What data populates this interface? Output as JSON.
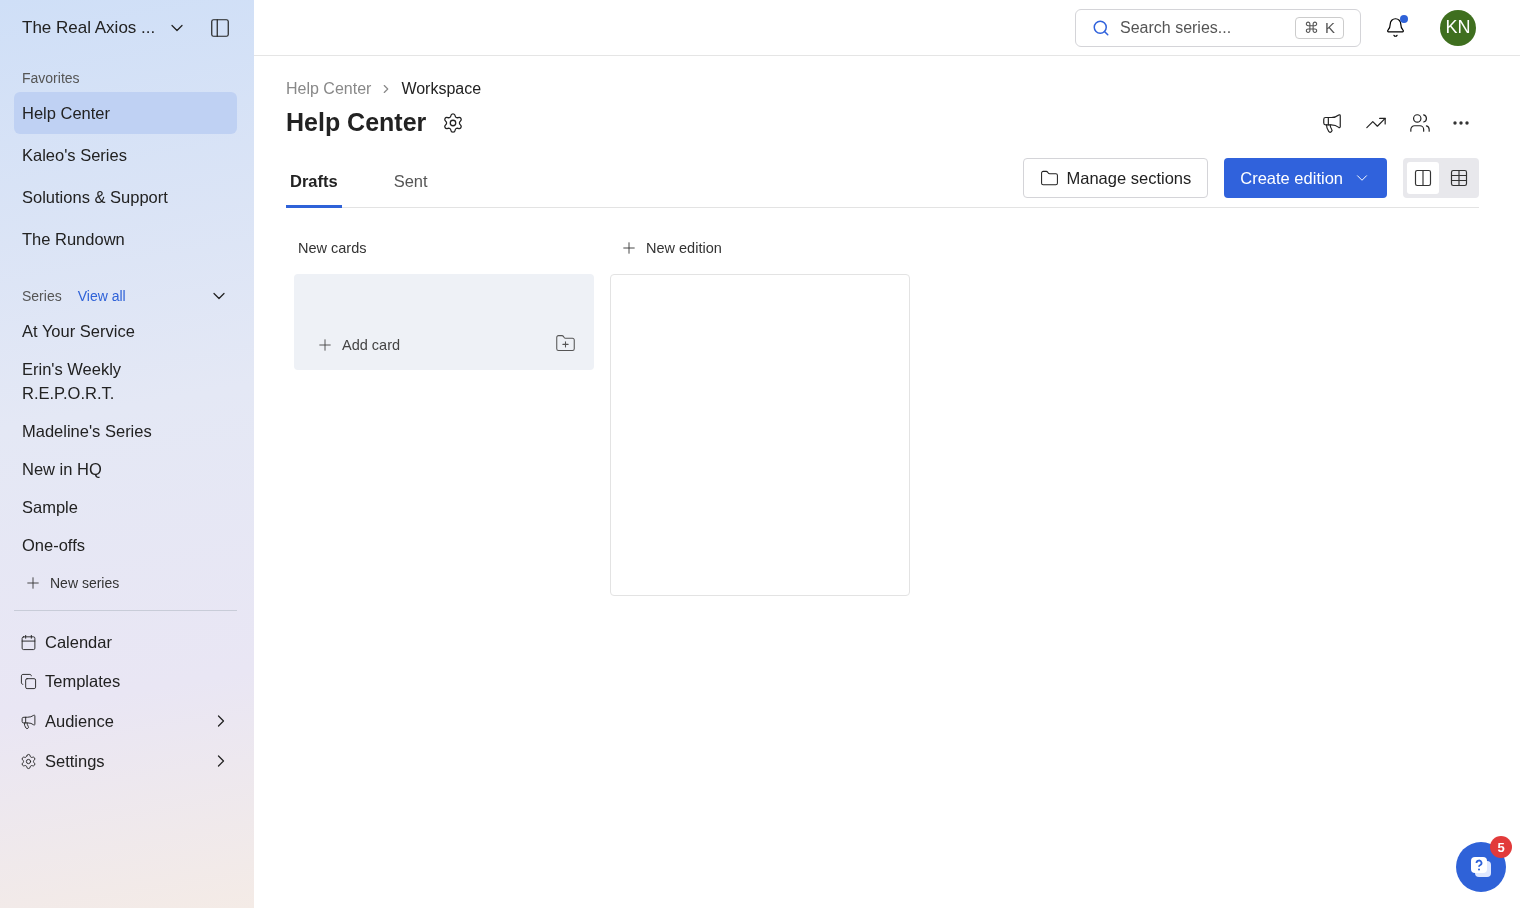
{
  "sidebar": {
    "workspace": "The Real Axios ...",
    "favorites": {
      "heading": "Favorites",
      "items": [
        {
          "label": "Help Center",
          "selected": true
        },
        {
          "label": "Kaleo's Series",
          "selected": false
        },
        {
          "label": "Solutions & Support",
          "selected": false
        },
        {
          "label": "The Rundown",
          "selected": false
        }
      ]
    },
    "series": {
      "heading": "Series",
      "view_all": "View all",
      "expanded": true,
      "items": [
        {
          "label": "At Your Service",
          "selected": false
        },
        {
          "label": "Erin's Weekly R.E.P.O.R.T.",
          "selected": false
        },
        {
          "label": "Madeline's Series",
          "selected": false
        },
        {
          "label": "New in HQ",
          "selected": false
        },
        {
          "label": "Sample",
          "selected": false
        },
        {
          "label": "One-offs",
          "selected": false
        }
      ],
      "new_series": "New series"
    },
    "nav": [
      {
        "kind": "calendar",
        "label": "Calendar",
        "submenu": false
      },
      {
        "kind": "templates",
        "label": "Templates",
        "submenu": false
      },
      {
        "kind": "audience",
        "label": "Audience",
        "submenu": true
      },
      {
        "kind": "settings",
        "label": "Settings",
        "submenu": true
      }
    ]
  },
  "topbar": {
    "search": {
      "placeholder": "Search series...",
      "shortcut": [
        "⌘",
        "K"
      ]
    },
    "notifications": {
      "unread": true
    },
    "avatar": "KN"
  },
  "breadcrumb": [
    "Help Center",
    "Workspace"
  ],
  "title": "Help Center",
  "tabs": [
    {
      "label": "Drafts",
      "selected": true
    },
    {
      "label": "Sent",
      "selected": false
    }
  ],
  "buttons": {
    "manage": "Manage sections",
    "create": "Create edition"
  },
  "view_toggle": [
    {
      "kind": "board",
      "selected": true
    },
    {
      "kind": "table",
      "selected": false
    }
  ],
  "board": {
    "new_cards": {
      "heading": "New cards",
      "add": "Add card"
    },
    "new_edition": "New edition"
  },
  "help": {
    "badge": "5"
  }
}
